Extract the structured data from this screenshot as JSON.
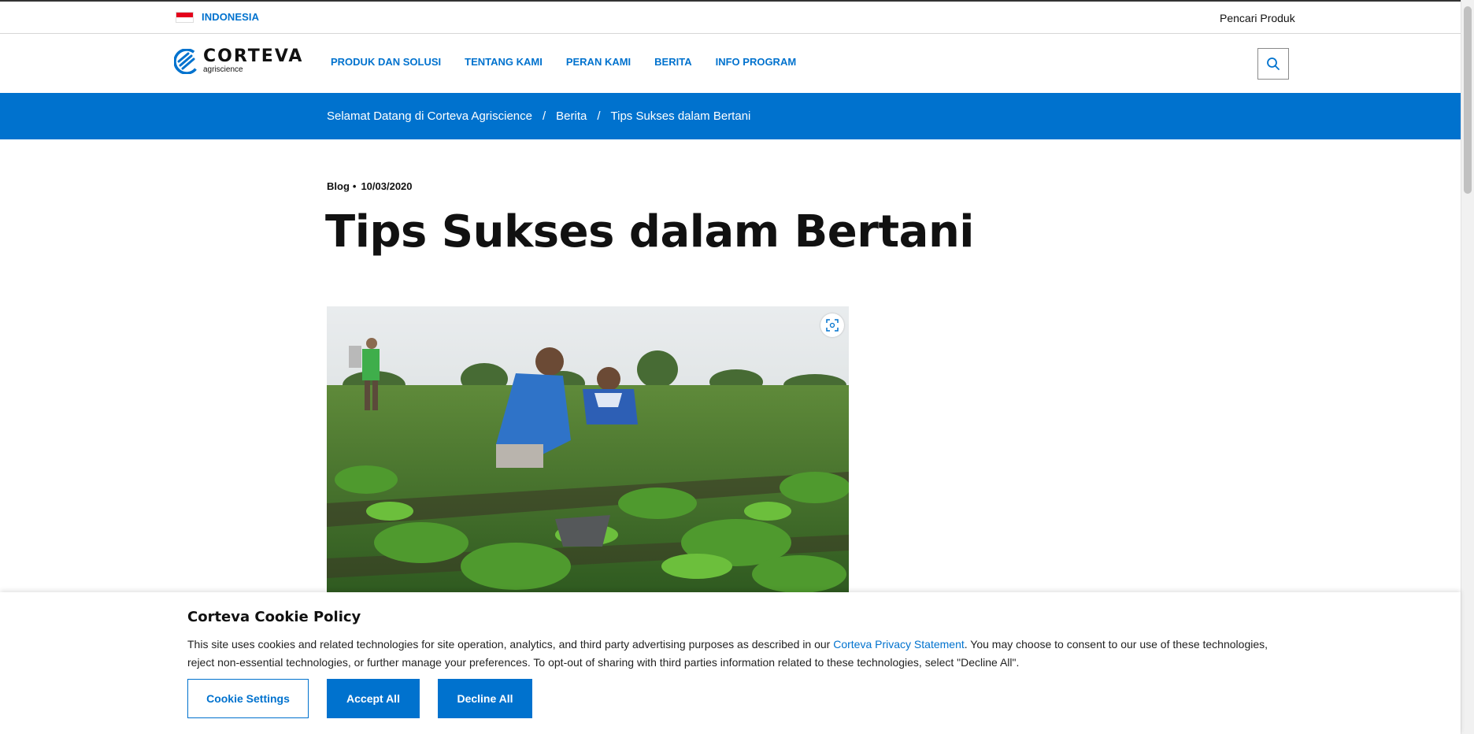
{
  "utility": {
    "country": "INDONESIA",
    "product_finder": "Pencari Produk"
  },
  "logo": {
    "wordmark": "CORTEVA",
    "tagline": "agriscience"
  },
  "nav": {
    "items": [
      "PRODUK DAN SOLUSI",
      "TENTANG KAMI",
      "PERAN KAMI",
      "BERITA",
      "INFO PROGRAM"
    ]
  },
  "breadcrumb": {
    "items": [
      "Selamat Datang di Corteva Agriscience",
      "Berita",
      "Tips Sukses dalam Bertani"
    ],
    "separator": "/"
  },
  "article": {
    "category": "Blog",
    "date": "10/03/2020",
    "title": "Tips Sukses dalam Bertani"
  },
  "cookie": {
    "title": "Corteva Cookie Policy",
    "text_before_link": "This site uses cookies and related technologies for site operation, analytics, and third party advertising purposes as described in our ",
    "link_text": "Corteva Privacy Statement",
    "text_after_link": ". You may choose to consent to our use of these technologies, reject non-essential technologies, or further manage your preferences. To opt-out of sharing with third parties information related to these technologies, select \"Decline All\".",
    "settings_label": "Cookie Settings",
    "accept_label": "Accept All",
    "decline_label": "Decline All"
  },
  "colors": {
    "brand_blue": "#0072ce",
    "text": "#111111"
  },
  "icons": {
    "search": "search-icon",
    "zoom": "expand-image-icon",
    "flag": "indonesia-flag-icon"
  }
}
